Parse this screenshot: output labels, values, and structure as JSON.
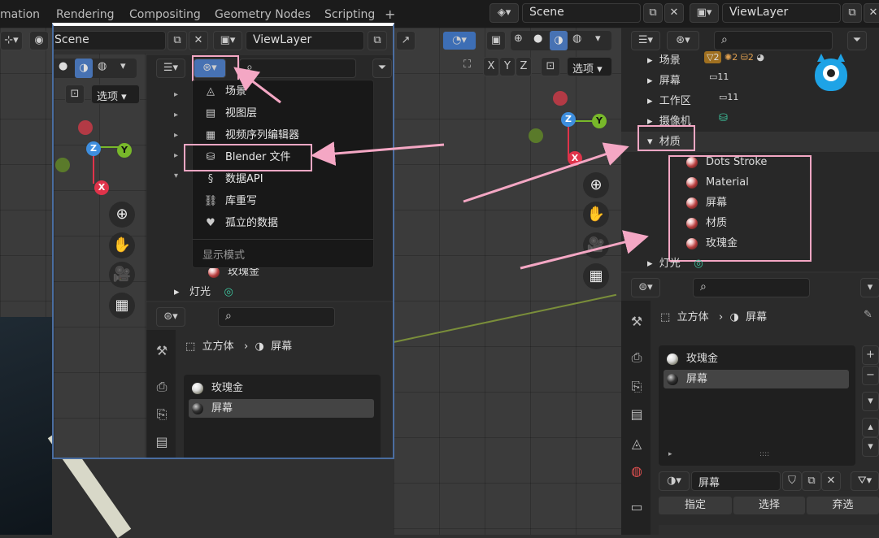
{
  "workspace_tabs": [
    "mation",
    "Rendering",
    "Compositing",
    "Geometry Nodes",
    "Scripting"
  ],
  "add_tab_label": "+",
  "top": {
    "scene_label": "Scene",
    "viewlayer_label": "ViewLayer"
  },
  "colors": {
    "accent_pink": "#f4a7c4",
    "gizmo_x": "#e0334a",
    "gizmo_y": "#78b82a",
    "gizmo_z": "#3e8ede"
  },
  "left_inset": {
    "scene_label": "Scene",
    "viewlayer_label": "ViewLayer",
    "options_label": "选项",
    "display_mode_menu": {
      "items": [
        {
          "icon": "scene-icon",
          "label": "场景"
        },
        {
          "icon": "view-layer-icon",
          "label": "视图层"
        },
        {
          "icon": "sequencer-icon",
          "label": "视频序列编辑器"
        },
        {
          "icon": "blender-file-icon",
          "label": "Blender 文件"
        },
        {
          "icon": "data-api-icon",
          "label": "数据API"
        },
        {
          "icon": "library-override-icon",
          "label": "库重写"
        },
        {
          "icon": "orphan-data-icon",
          "label": "孤立的数据"
        }
      ],
      "footer": "显示模式"
    },
    "outliner_rows": [
      "玫瑰金",
      "灯光"
    ],
    "properties": {
      "breadcrumb_object": "立方体",
      "breadcrumb_material": "屏幕",
      "slots": [
        "玫瑰金",
        "屏幕"
      ]
    }
  },
  "right_view": {
    "options_label": "选项",
    "axis_x": "X",
    "axis_y": "Y",
    "axis_z": "Z"
  },
  "outliner": {
    "rows": [
      {
        "label": "场景",
        "badges": [
          "2",
          "2",
          "2"
        ]
      },
      {
        "label": "屏幕",
        "badges": [
          "11"
        ]
      },
      {
        "label": "工作区",
        "badges": [
          "11"
        ]
      },
      {
        "label": "摄像机",
        "badges": []
      },
      {
        "label": "材质",
        "expanded": true
      }
    ],
    "materials": [
      "Dots Stroke",
      "Material",
      "屏幕",
      "材质",
      "玫瑰金"
    ],
    "last_row": "灯光"
  },
  "properties": {
    "breadcrumb_object": "立方体",
    "breadcrumb_material": "屏幕",
    "slots": [
      "玫瑰金",
      "屏幕"
    ],
    "material_name": "屏幕",
    "assign_label": "指定",
    "select_label": "选择",
    "deselect_label": "弃选",
    "drag_dots": "::::"
  }
}
